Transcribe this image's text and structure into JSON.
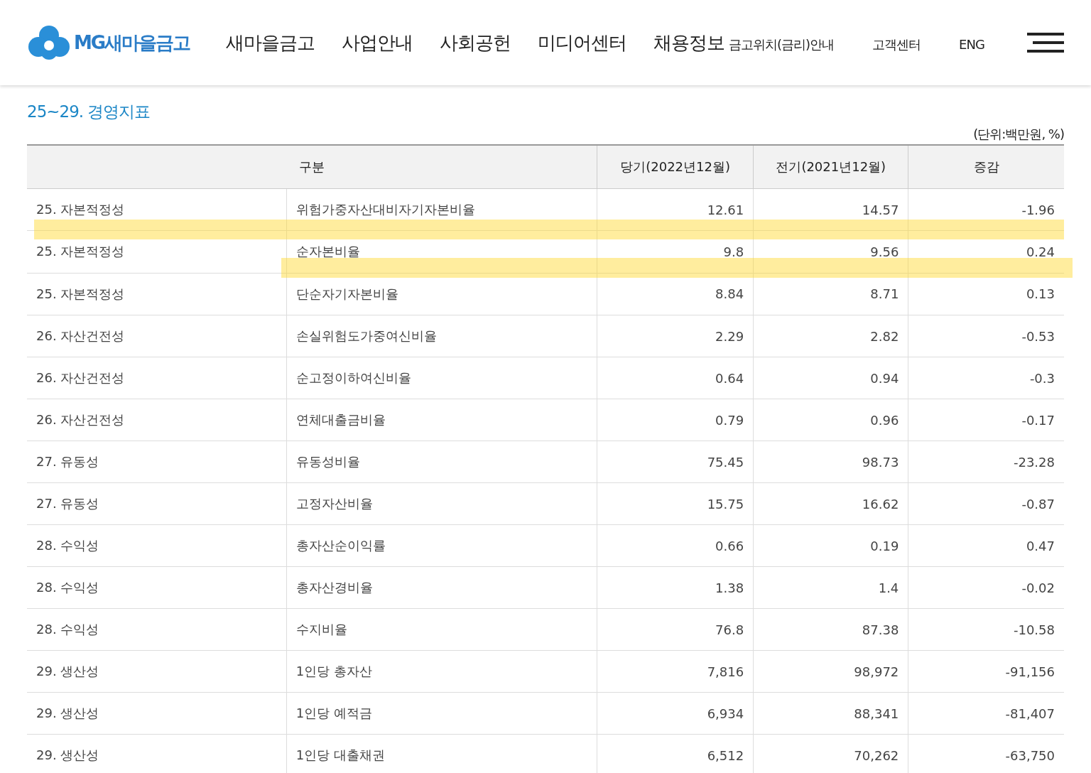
{
  "header": {
    "logo_text": "MG새마을금고",
    "nav": [
      {
        "label": "새마을금고",
        "kind": "main"
      },
      {
        "label": "사업안내",
        "kind": "main"
      },
      {
        "label": "사회공헌",
        "kind": "main"
      },
      {
        "label": "미디어센터",
        "kind": "main"
      },
      {
        "label": "채용정보",
        "kind": "main"
      },
      {
        "label": "금고위치(금리)안내",
        "kind": "sub"
      },
      {
        "label": "고객센터",
        "kind": "sub"
      },
      {
        "label": "ENG",
        "kind": "sub"
      }
    ]
  },
  "section_title": "25~29. 경영지표",
  "unit_note": "(단위:백만원, %)",
  "highlights": [
    {
      "kind": "wide"
    },
    {
      "kind": "narrow"
    }
  ],
  "table": {
    "heading_category": "구분",
    "heading_current": "당기(2022년12월)",
    "heading_previous": "전기(2021년12월)",
    "heading_change": "증감",
    "rows": [
      {
        "category": "25. 자본적정성",
        "item": "위험가중자산대비자기자본비율",
        "current": "12.61",
        "previous": "14.57",
        "change": "-1.96"
      },
      {
        "category": "25. 자본적정성",
        "item": "순자본비율",
        "current": "9.8",
        "previous": "9.56",
        "change": "0.24"
      },
      {
        "category": "25. 자본적정성",
        "item": "단순자기자본비율",
        "current": "8.84",
        "previous": "8.71",
        "change": "0.13"
      },
      {
        "category": "26. 자산건전성",
        "item": "손실위험도가중여신비율",
        "current": "2.29",
        "previous": "2.82",
        "change": "-0.53"
      },
      {
        "category": "26. 자산건전성",
        "item": "순고정이하여신비율",
        "current": "0.64",
        "previous": "0.94",
        "change": "-0.3"
      },
      {
        "category": "26. 자산건전성",
        "item": "연체대출금비율",
        "current": "0.79",
        "previous": "0.96",
        "change": "-0.17"
      },
      {
        "category": "27. 유동성",
        "item": "유동성비율",
        "current": "75.45",
        "previous": "98.73",
        "change": "-23.28"
      },
      {
        "category": "27. 유동성",
        "item": "고정자산비율",
        "current": "15.75",
        "previous": "16.62",
        "change": "-0.87"
      },
      {
        "category": "28. 수익성",
        "item": "총자산순이익률",
        "current": "0.66",
        "previous": "0.19",
        "change": "0.47"
      },
      {
        "category": "28. 수익성",
        "item": "총자산경비율",
        "current": "1.38",
        "previous": "1.4",
        "change": "-0.02"
      },
      {
        "category": "28. 수익성",
        "item": "수지비율",
        "current": "76.8",
        "previous": "87.38",
        "change": "-10.58"
      },
      {
        "category": "29. 생산성",
        "item": "1인당 총자산",
        "current": "7,816",
        "previous": "98,972",
        "change": "-91,156"
      },
      {
        "category": "29. 생산성",
        "item": "1인당 예적금",
        "current": "6,934",
        "previous": "88,341",
        "change": "-81,407"
      },
      {
        "category": "29. 생산성",
        "item": "1인당 대출채권",
        "current": "6,512",
        "previous": "70,262",
        "change": "-63,750"
      }
    ]
  }
}
